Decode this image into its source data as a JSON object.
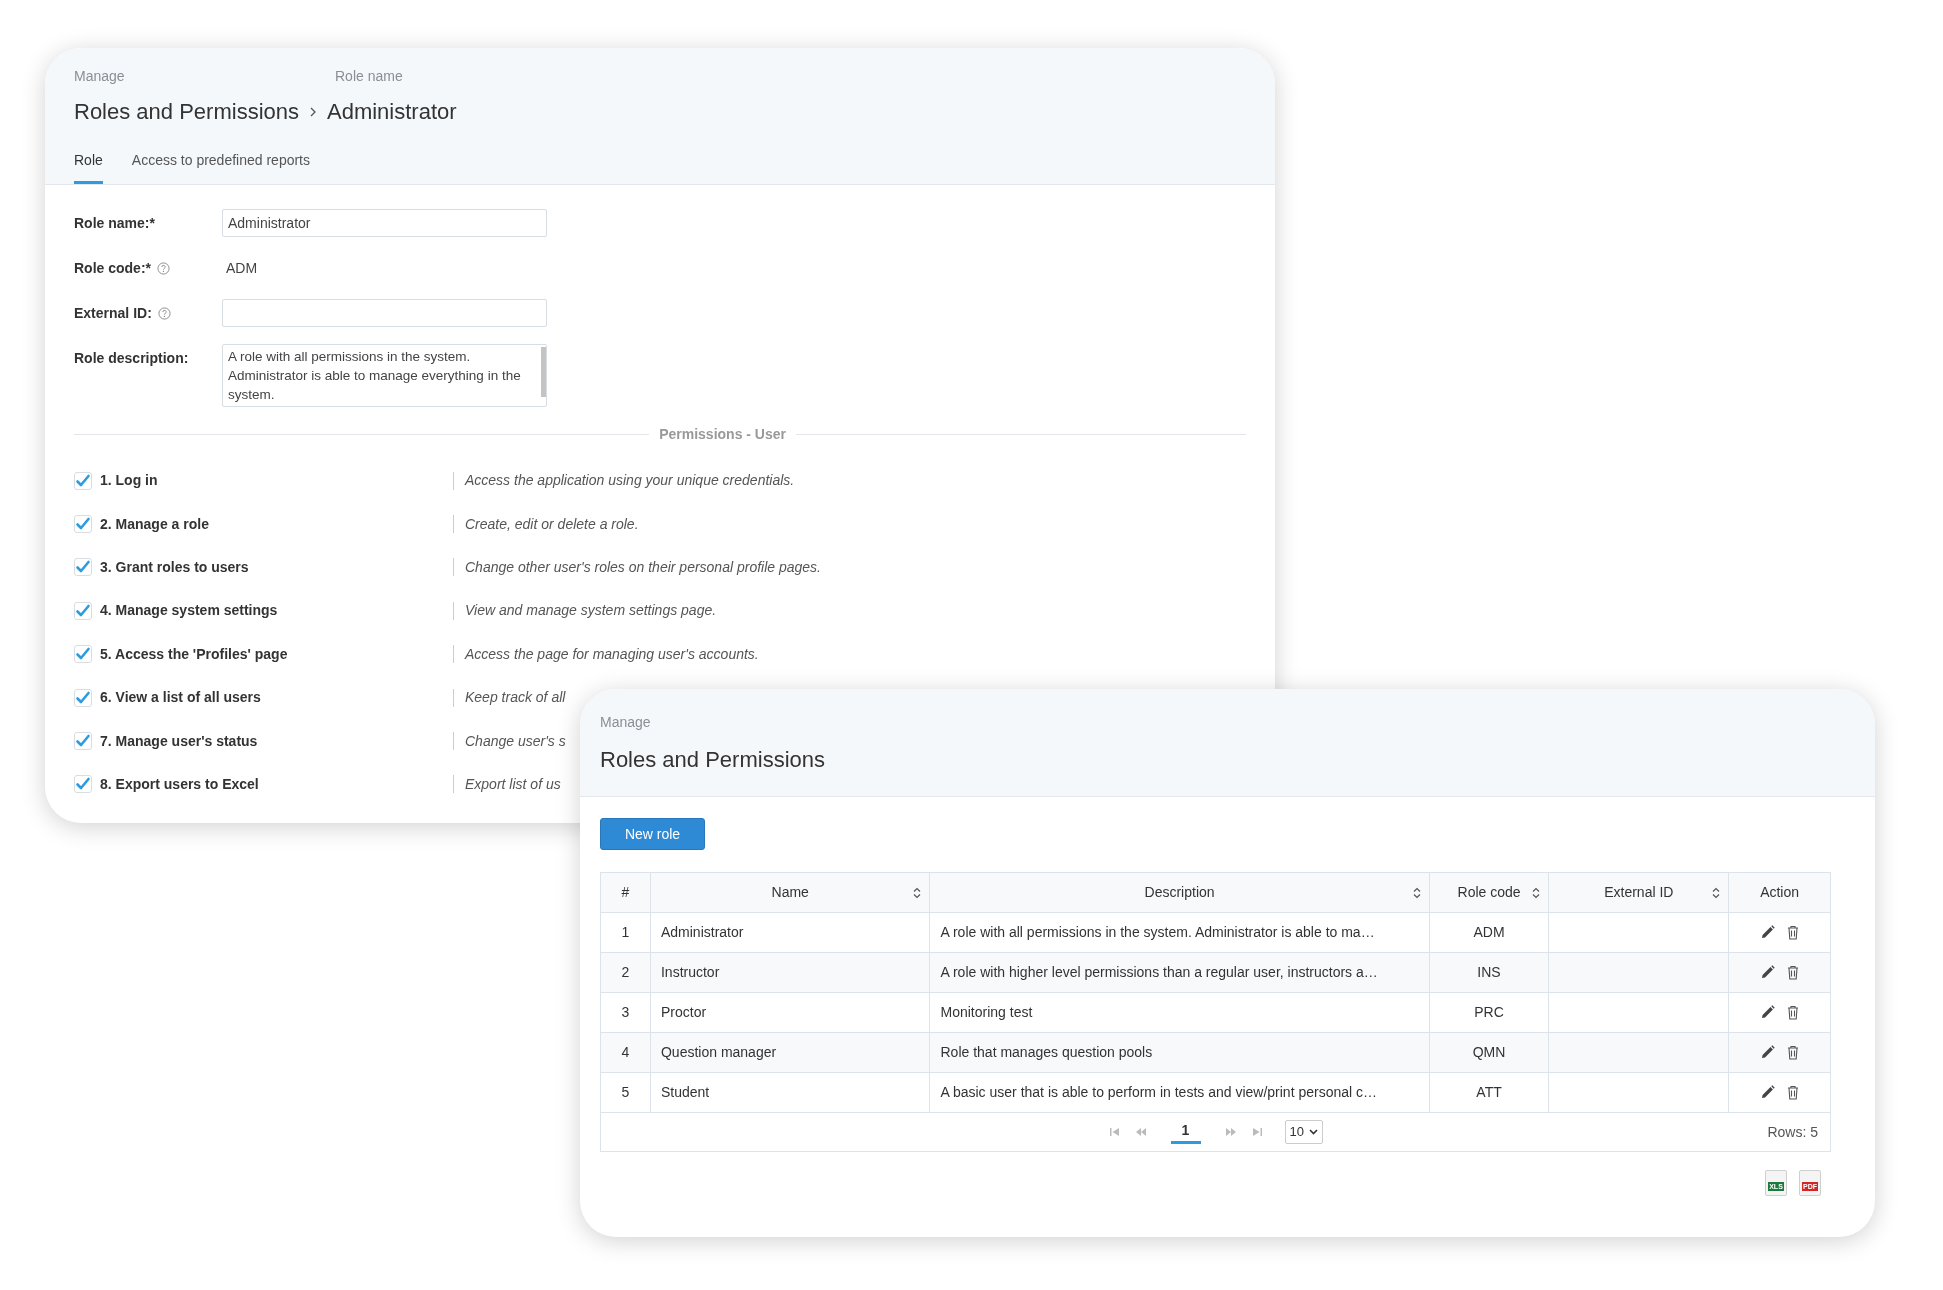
{
  "role_editor": {
    "breadcrumb_labels": [
      "Manage",
      "Role name"
    ],
    "breadcrumb": [
      "Roles and Permissions",
      "Administrator"
    ],
    "tabs": [
      {
        "label": "Role",
        "selected": true
      },
      {
        "label": "Access to predefined reports",
        "selected": false
      }
    ],
    "form": [
      {
        "kind": "input",
        "label": "Role name:*",
        "help": false,
        "value": "Administrator"
      },
      {
        "kind": "text",
        "label": "Role code:*",
        "help": true,
        "value": "ADM"
      },
      {
        "kind": "input",
        "label": "External ID:",
        "help": true
      },
      {
        "kind": "textarea",
        "label": "Role description:",
        "help": false,
        "value": "A role with all permissions in the system. Administrator is able to manage everything in the system."
      }
    ],
    "permissions": {
      "title": "Permissions - User",
      "items": [
        {
          "label": "1. Log in",
          "checked": true,
          "description": "Access the application using your unique credentials."
        },
        {
          "label": "2. Manage a role",
          "checked": true,
          "description": "Create, edit or delete a role."
        },
        {
          "label": "3. Grant roles to users",
          "checked": true,
          "description": "Change other user's roles on their personal profile pages."
        },
        {
          "label": "4. Manage system settings",
          "checked": true,
          "description": "View and manage system settings page."
        },
        {
          "label": "5. Access the 'Profiles' page",
          "checked": true,
          "description": "Access the page for managing user's accounts."
        },
        {
          "label": "6. View a list of all users",
          "checked": true,
          "description": "Keep track of all"
        },
        {
          "label": "7. Manage user's status",
          "checked": true,
          "description": "Change user's s"
        },
        {
          "label": "8. Export users to Excel",
          "checked": true,
          "description": "Export list of us"
        }
      ]
    }
  },
  "roles_list": {
    "section": "Manage",
    "title": "Roles and Permissions",
    "new_button": "New role",
    "table": {
      "columns": [
        {
          "label": "#",
          "sortable": false
        },
        {
          "label": "Name",
          "sortable": true
        },
        {
          "label": "Description",
          "sortable": true
        },
        {
          "label": "Role code",
          "sortable": true
        },
        {
          "label": "External ID",
          "sortable": true
        },
        {
          "label": "Action",
          "sortable": false
        }
      ],
      "rows": [
        {
          "cells": [
            "1",
            "Administrator",
            "A role with all permissions in the system. Administrator is able to ma…",
            "ADM"
          ]
        },
        {
          "cells": [
            "2",
            "Instructor",
            "A role with higher level permissions than a regular user, instructors a…",
            "INS"
          ]
        },
        {
          "cells": [
            "3",
            "Proctor",
            "Monitoring test",
            "PRC"
          ]
        },
        {
          "cells": [
            "4",
            "Question manager",
            "Role that manages question pools",
            "QMN"
          ]
        },
        {
          "cells": [
            "5",
            "Student",
            "A basic user that is able to perform in tests and view/print personal c…",
            "ATT"
          ]
        }
      ]
    },
    "pagination": {
      "pages": [
        {
          "label": "1",
          "selected": true
        }
      ],
      "page_size": "10",
      "rows_count": "Rows: 5"
    },
    "exports": [
      {
        "kind": "xls",
        "label": "XLS"
      },
      {
        "kind": "pdf",
        "label": "PDF"
      }
    ]
  }
}
